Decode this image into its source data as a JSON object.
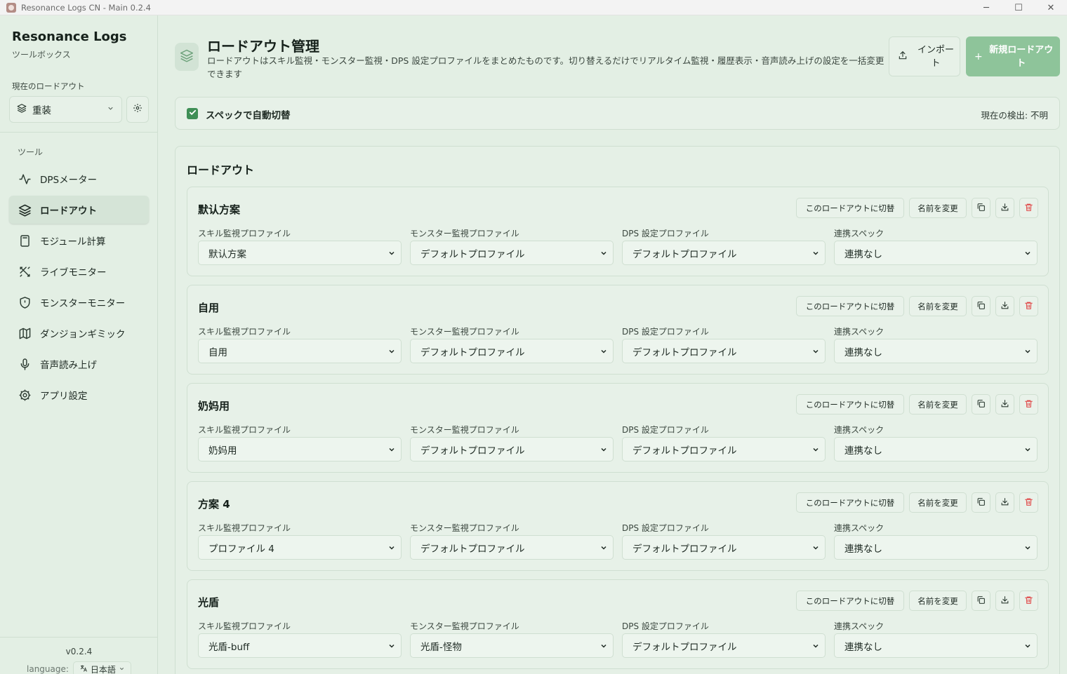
{
  "window": {
    "title": "Resonance Logs CN - Main 0.2.4",
    "minimize": "─",
    "maximize": "☐",
    "close": "✕"
  },
  "sidebar": {
    "brand_title": "Resonance Logs",
    "brand_sub": "ツールボックス",
    "current_loadout_label": "現在のロードアウト",
    "current_loadout_value": "重装",
    "tools_label": "ツール",
    "items": [
      {
        "label": "DPSメーター",
        "icon": "activity-icon",
        "active": false
      },
      {
        "label": "ロードアウト",
        "icon": "layers-icon",
        "active": true
      },
      {
        "label": "モジュール計算",
        "icon": "calculator-icon",
        "active": false
      },
      {
        "label": "ライブモニター",
        "icon": "swords-icon",
        "active": false
      },
      {
        "label": "モンスターモニター",
        "icon": "shield-icon",
        "active": false
      },
      {
        "label": "ダンジョンギミック",
        "icon": "map-icon",
        "active": false
      },
      {
        "label": "音声読み上げ",
        "icon": "microphone-icon",
        "active": false
      },
      {
        "label": "アプリ設定",
        "icon": "settings-icon",
        "active": false
      }
    ],
    "version": "v0.2.4",
    "language_label": "language:",
    "language_value": "日本語"
  },
  "header": {
    "title": "ロードアウト管理",
    "description": "ロードアウトはスキル監視・モンスター監視・DPS 設定プロファイルをまとめたものです。切り替えるだけでリアルタイム監視・履歴表示・音声読み上げの設定を一括変更できます",
    "import_label": "インポート",
    "new_label": "新規ロードアウト"
  },
  "auto_switch": {
    "label": "スペックで自動切替",
    "checked": true,
    "detect_text": "現在の検出: 不明"
  },
  "loadouts_section": {
    "title": "ロードアウト"
  },
  "field_labels": {
    "skill": "スキル監視プロファイル",
    "monster": "モンスター監視プロファイル",
    "dps": "DPS 設定プロファイル",
    "spec": "連携スペック"
  },
  "actions": {
    "switch": "このロードアウトに切替",
    "rename": "名前を変更"
  },
  "loadouts": [
    {
      "name": "默认方案",
      "skill": "默认方案",
      "monster": "デフォルトプロファイル",
      "dps": "デフォルトプロファイル",
      "spec": "連携なし"
    },
    {
      "name": "自用",
      "skill": "自用",
      "monster": "デフォルトプロファイル",
      "dps": "デフォルトプロファイル",
      "spec": "連携なし"
    },
    {
      "name": "奶妈用",
      "skill": "奶妈用",
      "monster": "デフォルトプロファイル",
      "dps": "デフォルトプロファイル",
      "spec": "連携なし"
    },
    {
      "name": "方案 4",
      "skill": "プロファイル 4",
      "monster": "デフォルトプロファイル",
      "dps": "デフォルトプロファイル",
      "spec": "連携なし"
    },
    {
      "name": "光盾",
      "skill": "光盾-buff",
      "monster": "光盾-怪物",
      "dps": "デフォルトプロファイル",
      "spec": "連携なし"
    }
  ],
  "colors": {
    "accent": "#8ec49a",
    "check": "#3f8f56",
    "danger": "#e04545",
    "background": "#e3efe4"
  }
}
